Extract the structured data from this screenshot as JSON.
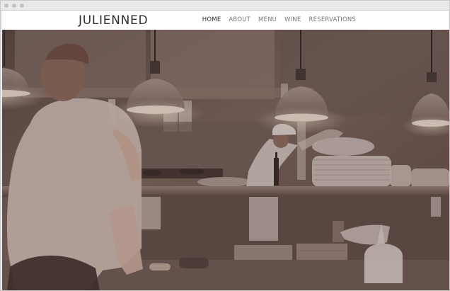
{
  "window": {
    "controls": [
      "close-dot",
      "minimize-dot",
      "zoom-dot"
    ]
  },
  "header": {
    "brand": "JULIENNED",
    "nav": [
      {
        "label": "HOME",
        "active": true
      },
      {
        "label": "ABOUT",
        "active": false
      },
      {
        "label": "MENU",
        "active": false
      },
      {
        "label": "WINE",
        "active": false
      },
      {
        "label": "RESERVATIONS",
        "active": false
      }
    ]
  },
  "hero": {
    "scene": "restaurant-kitchen-photo",
    "overlay_color": "#4b2d2a"
  },
  "colors": {
    "nav_bg": "#ffffff",
    "brand_text": "#2f2f2f",
    "nav_text": "#777777",
    "nav_active": "#2d2d2d"
  }
}
